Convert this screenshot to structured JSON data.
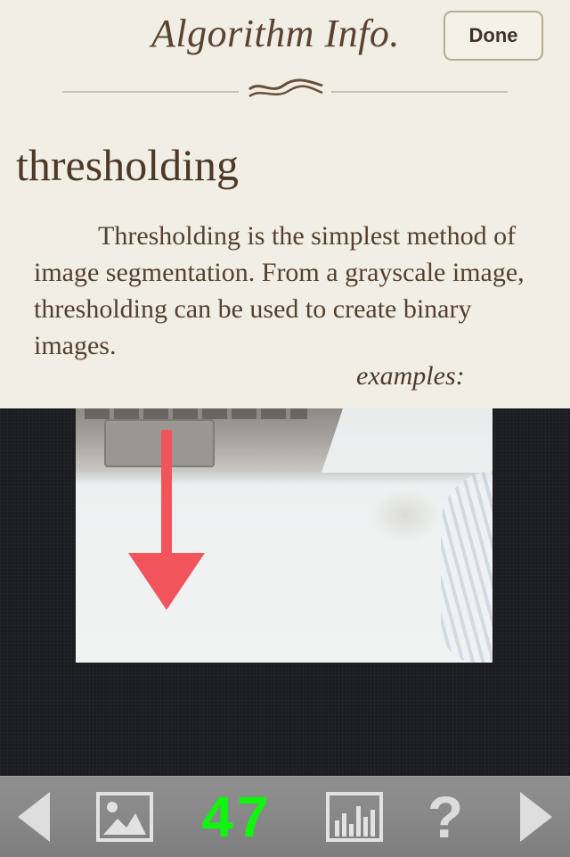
{
  "header": {
    "title": "Algorithm Info.",
    "done_label": "Done"
  },
  "info": {
    "heading": "thresholding",
    "body": "Thresholding is the simplest method of image segmentation. From a grayscale image, thresholding can be used to create binary images.",
    "examples_label": "examples:"
  },
  "toolbar": {
    "counter": "47",
    "help_label": "?",
    "counter_color": "#0ef50e",
    "icons": [
      "prev-arrow-icon",
      "image-icon",
      "histogram-icon",
      "help-icon",
      "next-arrow-icon"
    ]
  },
  "colors": {
    "panel_bg": "#f1eee5",
    "text_brown": "#5a4331",
    "stage_bg": "#1b1c1f",
    "arrow_red": "#f2545b"
  }
}
